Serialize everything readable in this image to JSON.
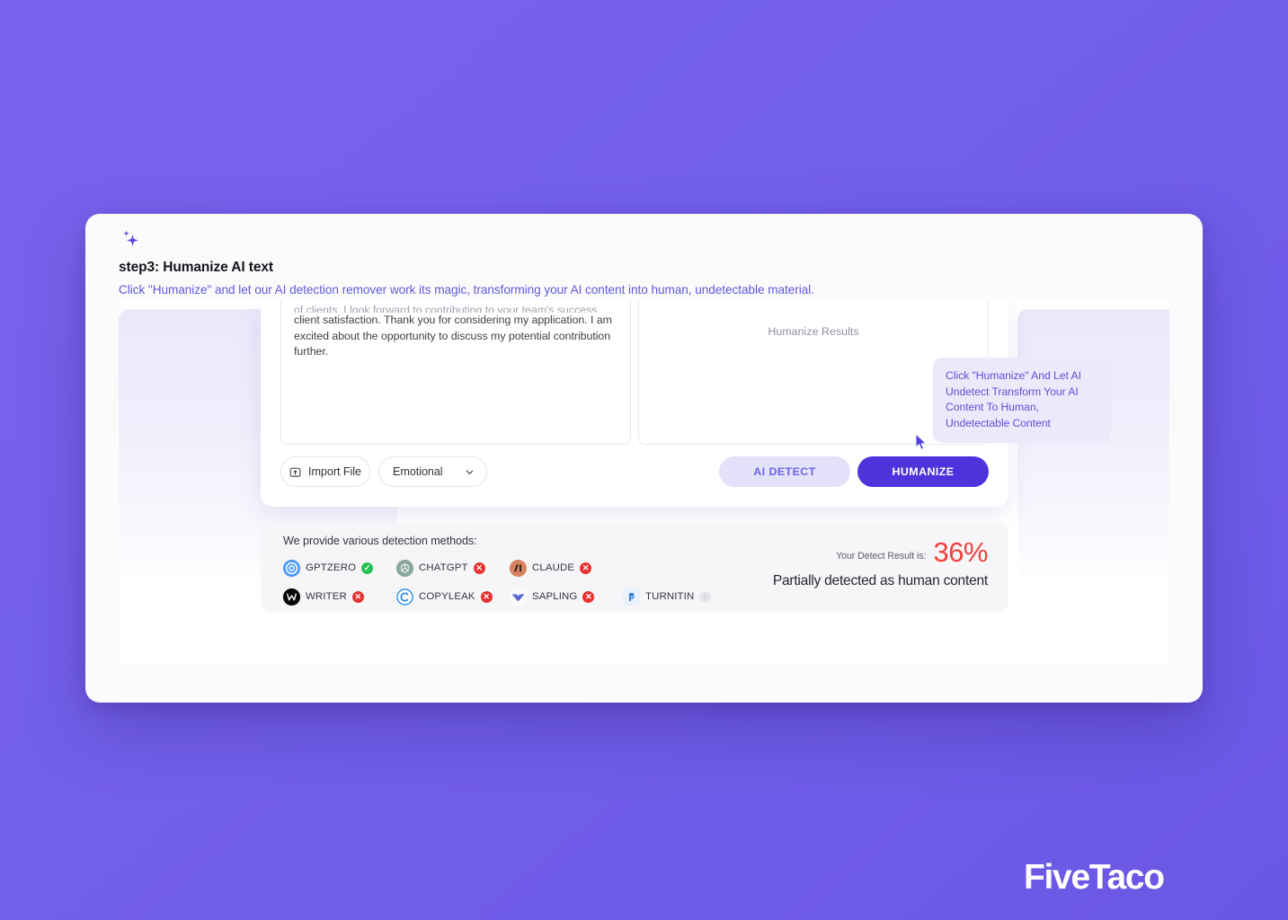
{
  "header": {
    "icon": "sparkle-icon",
    "title": "step3: Humanize AI text",
    "subtitle": "Click \"Humanize\" and let our AI detection remover work its magic, transforming your AI content into human, undetectable material."
  },
  "editor": {
    "source": {
      "clipped_line": "of clients. I look forward to contributing to your team's success and",
      "body": "client satisfaction. Thank you for considering my application. I am excited about the opportunity to discuss my potential contribution further."
    },
    "result": {
      "placeholder": "Humanize Results"
    },
    "controls": {
      "import_label": "Import File",
      "import_icon": "upload-file-icon",
      "tone_value": "Emotional",
      "tone_caret_icon": "chevron-down-icon",
      "ai_detect_label": "AI DETECT",
      "humanize_label": "HUMANIZE"
    },
    "tooltip": {
      "text": "Click \"Humanize\" And Let AI Undetect Transform Your AI Content To Human, Undetectable Content"
    },
    "cursor": "mouse-pointer-icon"
  },
  "methods": {
    "title": "We provide various detection methods:",
    "items": [
      {
        "name": "GPTZERO",
        "logo": "gptzero-logo",
        "logo_color": "#4c9bf5",
        "status": "pass",
        "status_glyph": "✓"
      },
      {
        "name": "CHATGPT",
        "logo": "chatgpt-logo",
        "logo_color": "#8aa79c",
        "status": "fail",
        "status_glyph": "✕"
      },
      {
        "name": "CLAUDE",
        "logo": "claude-logo",
        "logo_color": "#d8835f",
        "status": "fail",
        "status_glyph": "✕"
      },
      {
        "name": "WRITER",
        "logo": "writer-logo",
        "logo_color": "#000000",
        "status": "fail",
        "status_glyph": "✕"
      },
      {
        "name": "COPYLEAK",
        "logo": "copyleaks-logo",
        "logo_color": "#1e88e5",
        "status": "fail",
        "status_glyph": "✕"
      },
      {
        "name": "SAPLING",
        "logo": "sapling-logo",
        "logo_color": "#4f5ad6",
        "status": "fail",
        "status_glyph": "✕"
      },
      {
        "name": "TURNITIN",
        "logo": "turnitin-logo",
        "logo_color": "#2f7de1",
        "status": "idle",
        "status_glyph": "○"
      }
    ]
  },
  "result": {
    "label": "Your Detect Result is:",
    "percent": "36%",
    "percent_color": "#f0413c",
    "summary": "Partially detected as human content"
  },
  "brand": {
    "wordmark": "FiveTaco"
  },
  "theme": {
    "page_background": "#7360ea",
    "accent": "#4f34dd",
    "accent_soft": "#e4e1fb",
    "link": "#6257dd"
  }
}
